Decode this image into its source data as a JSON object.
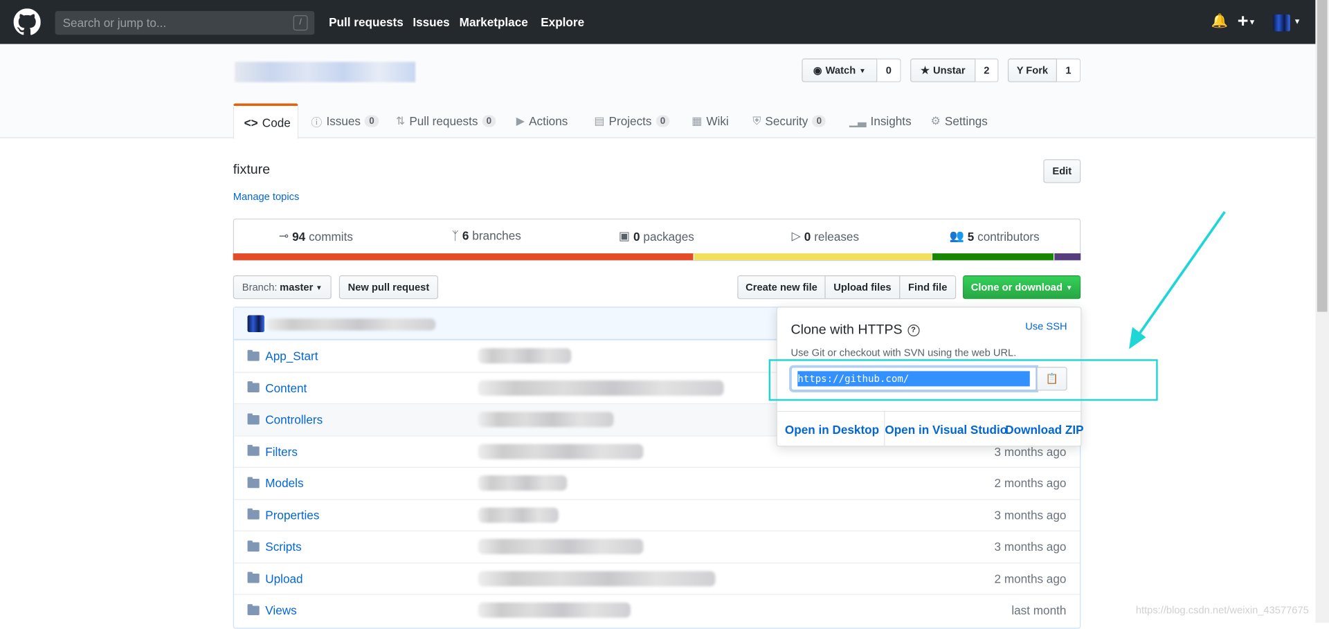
{
  "navbar": {
    "search_placeholder": "Search or jump to...",
    "search_shortcut": "/",
    "links": [
      "Pull requests",
      "Issues",
      "Marketplace",
      "Explore"
    ]
  },
  "repo_actions": {
    "watch": {
      "label": "Watch",
      "count": "0"
    },
    "star": {
      "label": "Unstar",
      "count": "2"
    },
    "fork": {
      "label": "Fork",
      "count": "1"
    }
  },
  "tabs": [
    {
      "label": "Code"
    },
    {
      "label": "Issues",
      "count": "0"
    },
    {
      "label": "Pull requests",
      "count": "0"
    },
    {
      "label": "Actions"
    },
    {
      "label": "Projects",
      "count": "0"
    },
    {
      "label": "Wiki"
    },
    {
      "label": "Security",
      "count": "0"
    },
    {
      "label": "Insights"
    },
    {
      "label": "Settings"
    }
  ],
  "description": "fixture",
  "edit_label": "Edit",
  "manage_topics": "Manage topics",
  "stats": [
    {
      "n": "94",
      "label": "commits"
    },
    {
      "n": "6",
      "label": "branches"
    },
    {
      "n": "0",
      "label": "packages"
    },
    {
      "n": "0",
      "label": "releases"
    },
    {
      "n": "5",
      "label": "contributors"
    }
  ],
  "language_colors": [
    "#e34c26",
    "#f1e05a",
    "#178600",
    "#563d7c"
  ],
  "language_shares": [
    54.3,
    28.1,
    14.4,
    3.2
  ],
  "toolbar": {
    "branch_prefix": "Branch:",
    "branch": "master",
    "new_pr": "New pull request",
    "create": "Create new file",
    "upload": "Upload files",
    "find": "Find file",
    "clone": "Clone or download"
  },
  "files": [
    {
      "name": "App_Start",
      "age": ""
    },
    {
      "name": "Content",
      "age": ""
    },
    {
      "name": "Controllers",
      "age": ""
    },
    {
      "name": "Filters",
      "age": "3 months ago"
    },
    {
      "name": "Models",
      "age": "2 months ago"
    },
    {
      "name": "Properties",
      "age": "3 months ago"
    },
    {
      "name": "Scripts",
      "age": "3 months ago"
    },
    {
      "name": "Upload",
      "age": "2 months ago"
    },
    {
      "name": "Views",
      "age": "last month"
    }
  ],
  "clone_popup": {
    "title": "Clone with HTTPS",
    "use_ssh": "Use SSH",
    "hint": "Use Git or checkout with SVN using the web URL.",
    "url": "https://github.com/",
    "open_desktop": "Open in Desktop",
    "open_vs": "Open in Visual Studio",
    "download_zip": "Download ZIP"
  },
  "watermark": "https://blog.csdn.net/weixin_43577675",
  "annotation_color": "#1fd6d6"
}
